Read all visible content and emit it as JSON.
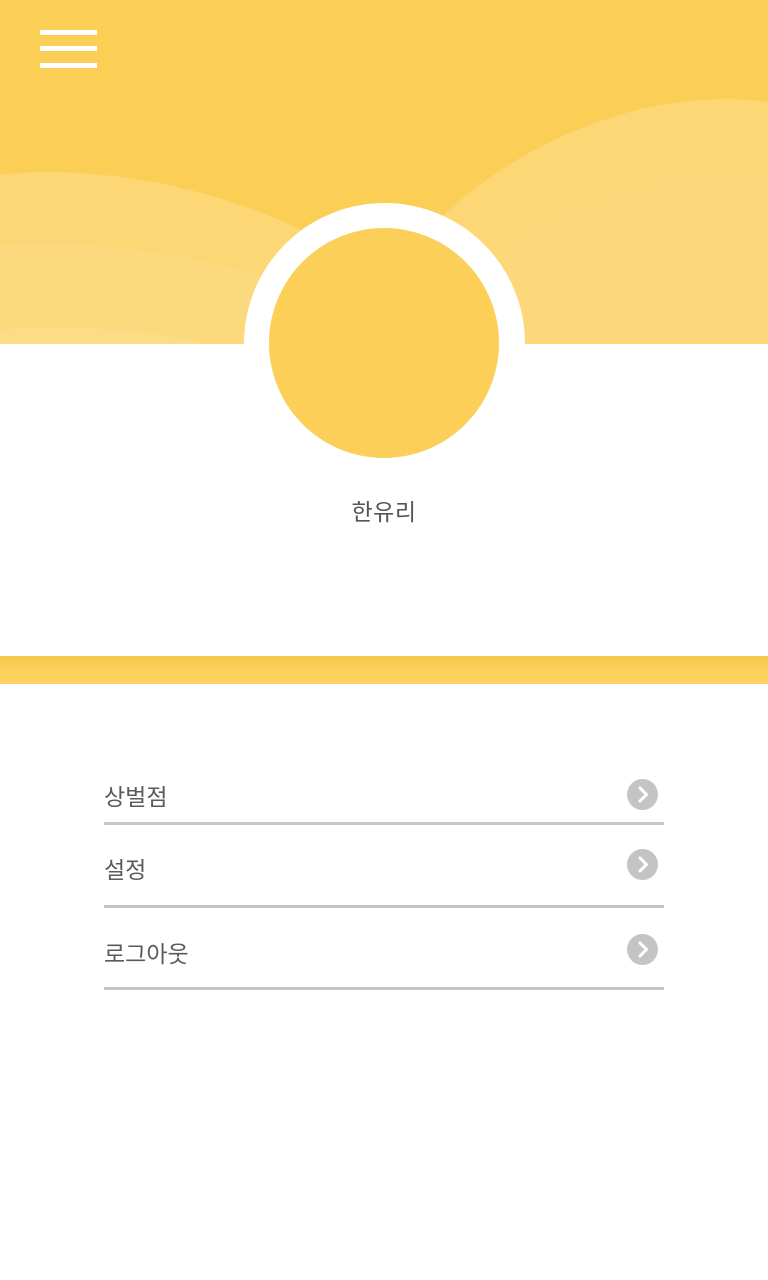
{
  "header": {
    "menu_icon": "hamburger-menu-icon",
    "background_color": "#fbce55"
  },
  "profile": {
    "avatar_color": "#fbcf58",
    "name": "한유리"
  },
  "menu": {
    "items": [
      {
        "label": "상벌점",
        "icon": "chevron-right-icon"
      },
      {
        "label": "설정",
        "icon": "chevron-right-icon"
      },
      {
        "label": "로그아웃",
        "icon": "chevron-right-icon"
      }
    ]
  },
  "colors": {
    "accent": "#fbce55",
    "divider": "#c6c6c6",
    "text": "#5a5a5a",
    "chevron_bg": "#c4c4c4"
  }
}
